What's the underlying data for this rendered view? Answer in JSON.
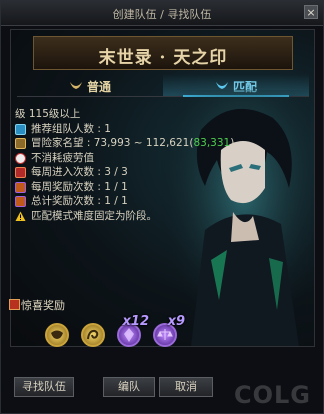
{
  "window": {
    "title": "创建队伍 / 寻找队伍",
    "close_glyph": "×"
  },
  "banner": {
    "text": "末世录 · 天之印"
  },
  "tabs": [
    {
      "label": "普通",
      "icon": "demon-horns-icon",
      "active": false
    },
    {
      "label": "匹配",
      "icon": "demon-horns-icon",
      "active": true
    }
  ],
  "info": {
    "level": "级 115级以上",
    "recommended_members": "推荐组队人数 : 1",
    "adventurer_fame_prefix": "冒险家名望 : 73,993 ~ 112,621(",
    "adventurer_fame_current": "83,331",
    "adventurer_fame_suffix": ")",
    "no_fatigue": "不消耗疲劳值",
    "weekly_entries": "每周进入次数 : 3 / 3",
    "weekly_rewards": "每周奖励次数 : 1 / 1",
    "total_rewards": "总计奖励次数 : 1 / 1",
    "warning": "匹配模式难度固定为阶段。"
  },
  "rewards": {
    "title": "惊喜奖励",
    "items": [
      {
        "icon": "gold-mask-medal-icon",
        "qty": ""
      },
      {
        "icon": "gold-spiral-medal-icon",
        "qty": ""
      },
      {
        "icon": "purple-crystal-icon",
        "qty": "x12"
      },
      {
        "icon": "purple-scale-icon",
        "qty": "x9"
      }
    ]
  },
  "buttons": {
    "find_team": "寻找队伍",
    "form_team": "编队",
    "cancel": "取消"
  },
  "watermark": "COLG",
  "colors": {
    "accent_blue": "#3fb6e0",
    "gold": "#e3d3a3",
    "green": "#4fcf4f",
    "purple": "#b79aff"
  }
}
